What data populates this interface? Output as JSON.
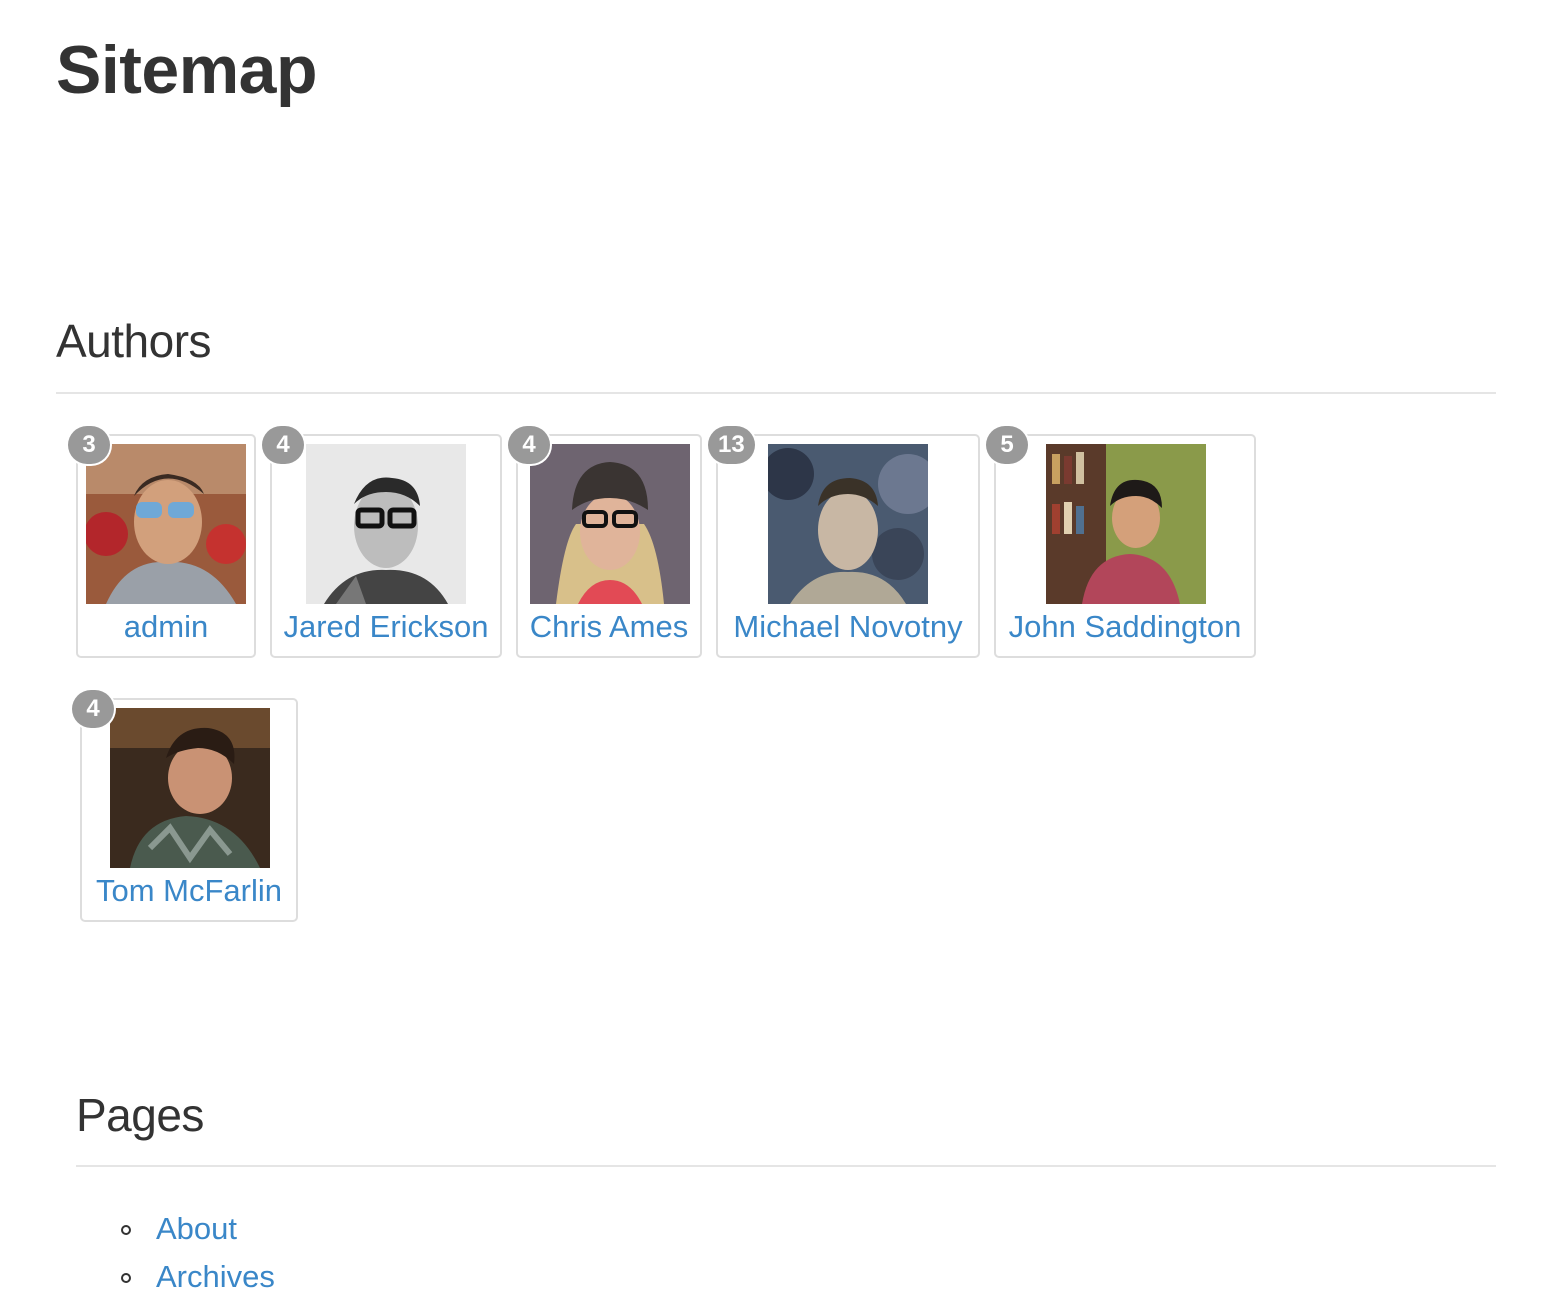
{
  "page": {
    "title": "Sitemap"
  },
  "authors": {
    "heading": "Authors",
    "items": [
      {
        "name": "admin",
        "post_count": "3"
      },
      {
        "name": "Jared Erickson",
        "post_count": "4"
      },
      {
        "name": "Chris Ames",
        "post_count": "4"
      },
      {
        "name": "Michael Novotny",
        "post_count": "13"
      },
      {
        "name": "John Saddington",
        "post_count": "5"
      },
      {
        "name": "Tom McFarlin",
        "post_count": "4"
      }
    ]
  },
  "pages": {
    "heading": "Pages",
    "items": [
      {
        "label": "About"
      },
      {
        "label": "Archives"
      }
    ]
  },
  "colors": {
    "link": "#3a87c8",
    "badge": "#999999",
    "text": "#333333",
    "rule": "#e5e5e5"
  }
}
